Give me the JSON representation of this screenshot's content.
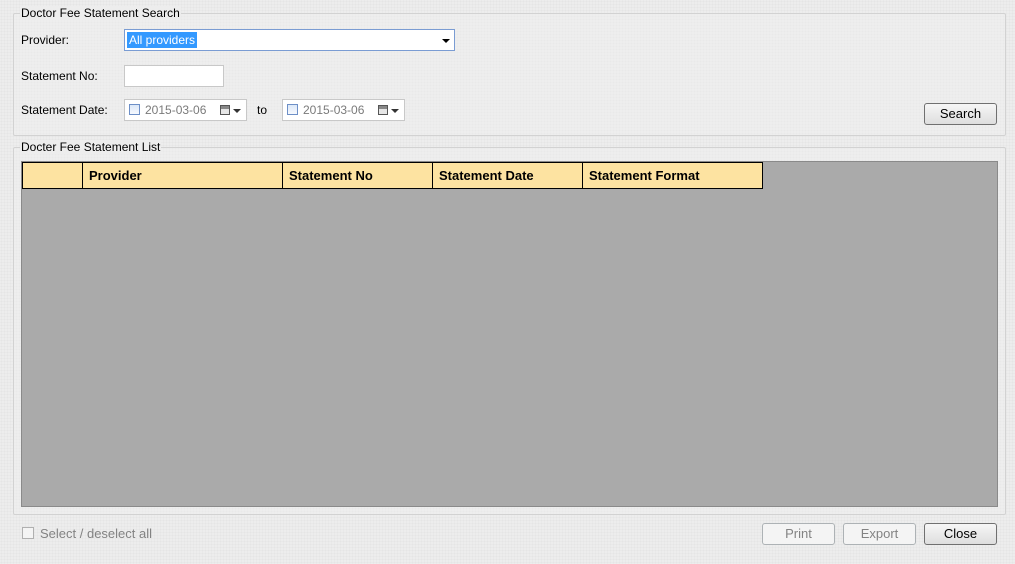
{
  "search_group": {
    "title": "Doctor Fee Statement Search",
    "provider_label": "Provider:",
    "provider_value": "All providers",
    "statement_no_label": "Statement No:",
    "statement_no_value": "",
    "statement_date_label": "Statement Date:",
    "date_from": "2015-03-06",
    "to_label": "to",
    "date_to": "2015-03-06",
    "search_button": "Search"
  },
  "list_group": {
    "title": "Docter Fee Statement List",
    "columns": [
      "",
      "Provider",
      "Statement No",
      "Statement Date",
      "Statement Format"
    ],
    "rows": []
  },
  "footer": {
    "select_all_label": "Select / deselect all",
    "print_button": "Print",
    "export_button": "Export",
    "close_button": "Close"
  },
  "colors": {
    "header_bg": "#fde3a1",
    "grid_bg": "#aaaaaa",
    "selection": "#3399ff"
  }
}
